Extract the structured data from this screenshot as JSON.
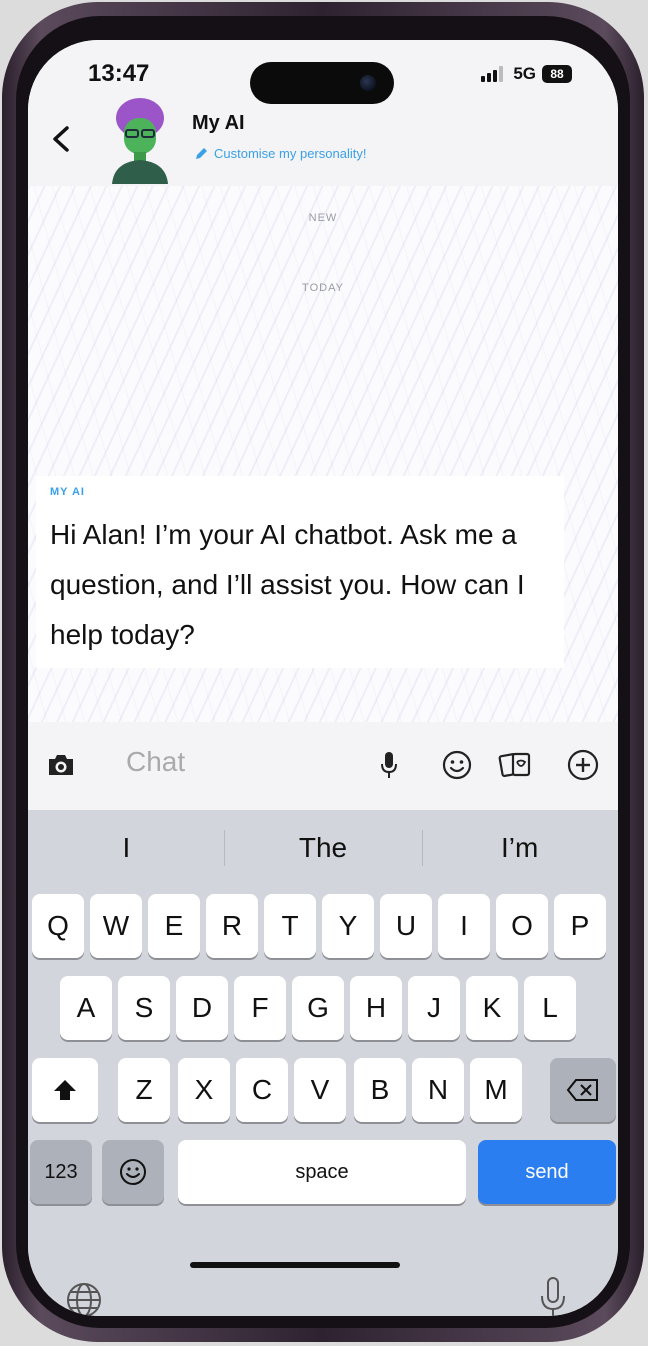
{
  "status": {
    "time": "13:47",
    "network": "5G",
    "battery": "88"
  },
  "header": {
    "title": "My AI",
    "subtitle": "Customise my personality!"
  },
  "chat": {
    "labels": [
      "NEW",
      "TODAY"
    ],
    "message": {
      "sender": "MY AI",
      "text": "Hi Alan! I’m your AI chatbot. Ask me a question, and I’ll assist you. How can I help today?"
    }
  },
  "input": {
    "placeholder": "Chat"
  },
  "keyboard": {
    "suggestions": [
      "I",
      "The",
      "I’m"
    ],
    "row1": [
      "Q",
      "W",
      "E",
      "R",
      "T",
      "Y",
      "U",
      "I",
      "O",
      "P"
    ],
    "row2": [
      "A",
      "S",
      "D",
      "F",
      "G",
      "H",
      "J",
      "K",
      "L"
    ],
    "row3": [
      "Z",
      "X",
      "C",
      "V",
      "B",
      "N",
      "M"
    ],
    "numbers_key": "123",
    "space_key": "space",
    "send_key": "send"
  },
  "colors": {
    "accent": "#3aa0e8",
    "send": "#2b7ef0"
  },
  "icons": [
    "back-icon",
    "avatar",
    "pencil-icon",
    "camera-icon",
    "microphone-icon",
    "emoji-icon",
    "stickers-icon",
    "plus-icon",
    "shift-icon",
    "backspace-icon",
    "emoji-key-icon",
    "globe-icon",
    "dictation-mic-icon"
  ]
}
